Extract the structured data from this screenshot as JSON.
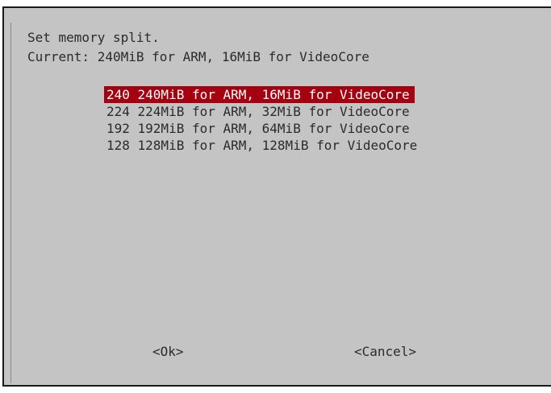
{
  "dialog": {
    "prompt": [
      "Set memory split.",
      "Current: 240MiB for ARM, 16MiB for VideoCore"
    ]
  },
  "menu": {
    "selected_index": 0,
    "items": [
      "240 240MiB for ARM, 16MiB for VideoCore",
      "224 224MiB for ARM, 32MiB for VideoCore",
      "192 192MiB for ARM, 64MiB for VideoCore",
      "128 128MiB for ARM, 128MiB for VideoCore"
    ]
  },
  "buttons": {
    "ok": "<Ok>",
    "cancel": "<Cancel>"
  },
  "colors": {
    "background": "#c4c4c4",
    "selection": "#a5000f",
    "selection_text": "#ffffff",
    "text": "#2b2b2b"
  }
}
